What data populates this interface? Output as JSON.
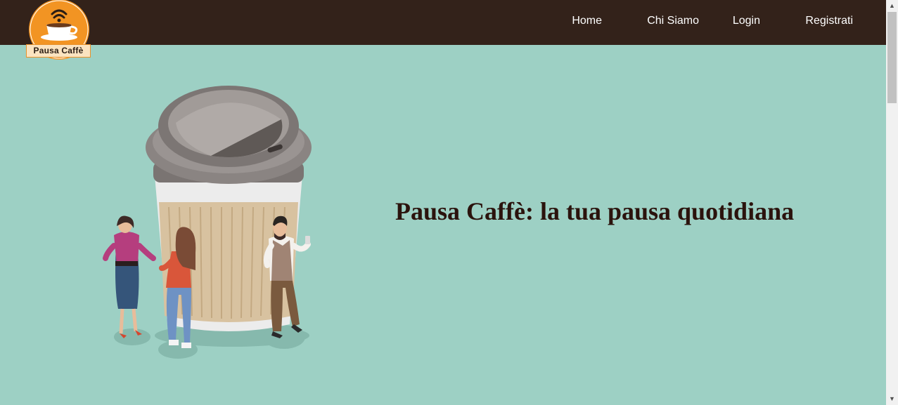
{
  "logo": {
    "text": "Pausa Caffè"
  },
  "nav": {
    "items": [
      {
        "label": "Home"
      },
      {
        "label": "Chi Siamo"
      },
      {
        "label": "Login"
      },
      {
        "label": "Registrati"
      }
    ]
  },
  "hero": {
    "title": "Pausa Caffè: la tua pausa quotidiana",
    "illustration": "coffee-cup-people-illustration"
  },
  "colors": {
    "navbar": "#33221a",
    "background": "#9dd0c4",
    "title": "#2b130d",
    "logo_accent": "#f29423"
  }
}
